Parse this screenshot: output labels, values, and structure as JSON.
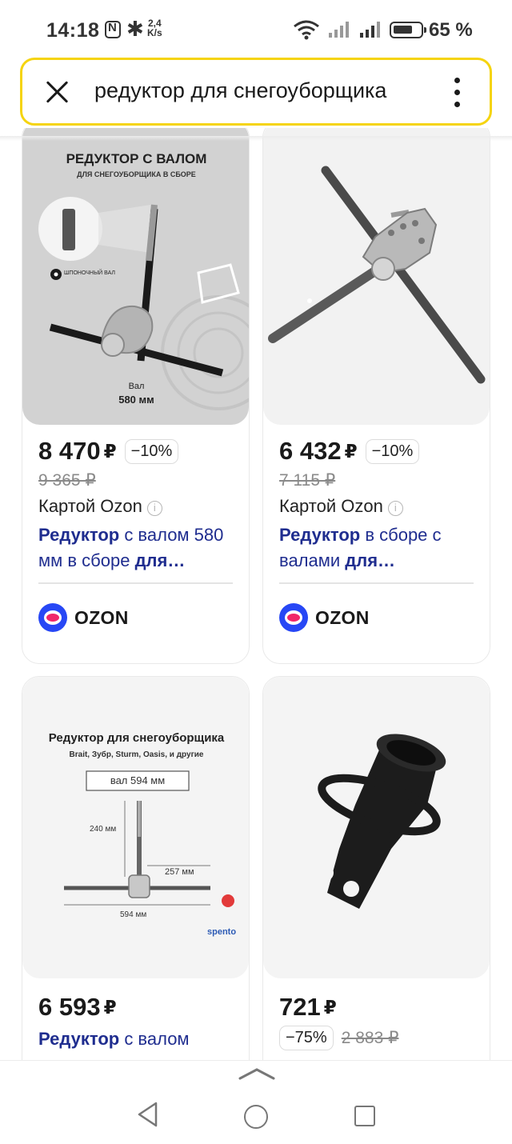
{
  "status_bar": {
    "time": "14:18",
    "speed": "2,4\nK/s",
    "battery_percent": "65 %",
    "battery_level": 0.65
  },
  "search": {
    "query": "редуктор для снегоуборщика"
  },
  "cards": [
    {
      "image": {
        "headline": "РЕДУКТОР С ВАЛОМ",
        "subhead": "ДЛЯ СНЕГОУБОРЩИКА В СБОРЕ",
        "key_label": "ШПОНОЧНЫЙ ВАЛ",
        "shaft_label": "Вал",
        "shaft_length": "580 мм"
      },
      "price": "8 470",
      "currency": "₽",
      "discount": "−10%",
      "old_price": "9 365 ₽",
      "payment": "Картой Ozon",
      "title_bold": "Редуктор",
      "title_rest": " с валом 580 мм в сборе ",
      "title_bold2": "для…",
      "shop": "OZON"
    },
    {
      "price": "6 432",
      "currency": "₽",
      "discount": "−10%",
      "old_price": "7 115 ₽",
      "payment": "Картой Ozon",
      "title_bold": "Редуктор",
      "title_rest": " в сборе с валами ",
      "title_bold2": "для…",
      "shop": "OZON"
    },
    {
      "image": {
        "headline": "Редуктор для снегоуборщика",
        "subhead": "Brait, Зубр, Sturm, Oasis, и другие",
        "shaft_box": "вал 594 мм",
        "dim_vertical": "240 мм",
        "dim_right": "257 мм",
        "dim_total": "594 мм",
        "brand": "spento"
      },
      "price": "6 593",
      "currency": "₽",
      "title_bold": "Редуктор",
      "title_rest": " с валом"
    },
    {
      "price": "721",
      "currency": "₽",
      "discount": "−75%",
      "old_price": "2 883 ₽"
    }
  ]
}
